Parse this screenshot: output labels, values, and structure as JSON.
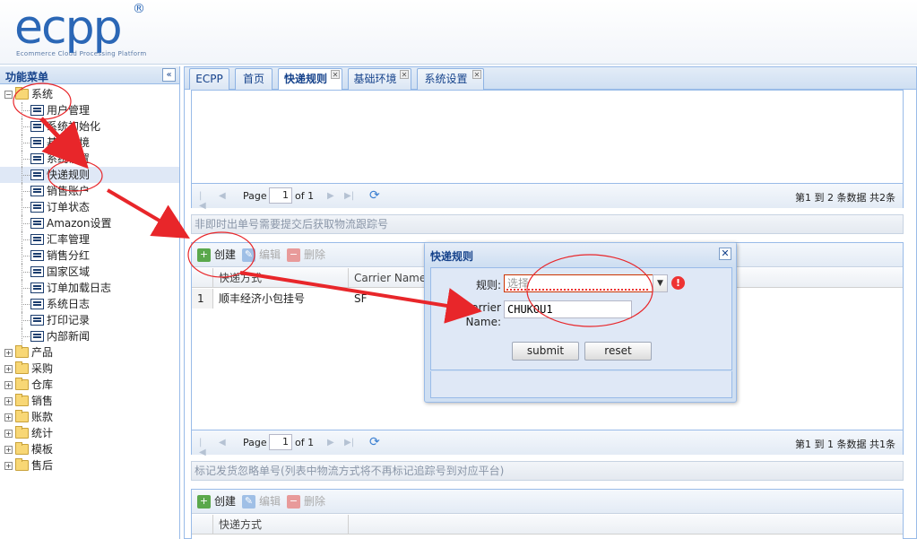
{
  "header": {
    "logo_text": "ecpp",
    "logo_reg": "®",
    "logo_subtitle": "Ecommerce Cloud Processing Platform"
  },
  "sidebar": {
    "title": "功能菜单",
    "collapse_glyph": "«",
    "root": {
      "label": "系统",
      "expanded": true
    },
    "children": [
      {
        "label": "用户管理"
      },
      {
        "label": "系统初始化"
      },
      {
        "label": "基础环境"
      },
      {
        "label": "系统设置"
      },
      {
        "label": "快递规则",
        "selected": true
      },
      {
        "label": "销售账户"
      },
      {
        "label": "订单状态"
      },
      {
        "label": "Amazon设置"
      },
      {
        "label": "汇率管理"
      },
      {
        "label": "销售分红"
      },
      {
        "label": "国家区域"
      },
      {
        "label": "订单加载日志"
      },
      {
        "label": "系统日志"
      },
      {
        "label": "打印记录"
      },
      {
        "label": "内部新闻"
      }
    ],
    "folders": [
      {
        "label": "产品"
      },
      {
        "label": "采购"
      },
      {
        "label": "仓库"
      },
      {
        "label": "销售"
      },
      {
        "label": "账款"
      },
      {
        "label": "统计"
      },
      {
        "label": "模板"
      },
      {
        "label": "售后"
      }
    ]
  },
  "tabs": [
    {
      "label": "ECPP",
      "closable": false
    },
    {
      "label": "首页",
      "closable": false
    },
    {
      "label": "快递规则",
      "closable": true,
      "active": true
    },
    {
      "label": "基础环境",
      "closable": true
    },
    {
      "label": "系统设置",
      "closable": true
    }
  ],
  "pager": {
    "page_label": "Page",
    "of_label": "of 1",
    "current_page": "1"
  },
  "grid1": {
    "info": "第1 到 2 条数据 共2条"
  },
  "section2": {
    "title": "非即时出单号需要提交后获取物流跟踪号",
    "toolbar": {
      "create": "创建",
      "edit": "编辑",
      "delete": "删除"
    },
    "columns": [
      "快递方式",
      "Carrier Name"
    ],
    "rows": [
      {
        "num": "1",
        "cells": [
          "顺丰经济小包挂号",
          "SF"
        ]
      }
    ],
    "info": "第1 到 1 条数据 共1条"
  },
  "section3": {
    "title": "标记发货忽略单号(列表中物流方式将不再标记追踪号到对应平台)",
    "toolbar": {
      "create": "创建",
      "edit": "编辑",
      "delete": "删除"
    },
    "columns": [
      "快递方式"
    ]
  },
  "modal": {
    "title": "快递规则",
    "close_glyph": "✕",
    "rule_label": "规则:",
    "rule_placeholder": "选择",
    "carrier_label_1": "Carrier",
    "carrier_label_2": "Name:",
    "carrier_value": "CHUKOU1",
    "submit": "submit",
    "reset": "reset",
    "error_glyph": "!"
  },
  "colors": {
    "accent": "#15428b",
    "border": "#99bbe8",
    "annotation": "#e8262a"
  },
  "icons": {
    "collapse": "double-chevron-left-icon",
    "folder": "folder-icon",
    "leaf": "document-icon",
    "create": "plus-icon",
    "edit": "pencil-icon",
    "delete": "minus-icon",
    "refresh": "refresh-icon",
    "error": "error-icon"
  }
}
